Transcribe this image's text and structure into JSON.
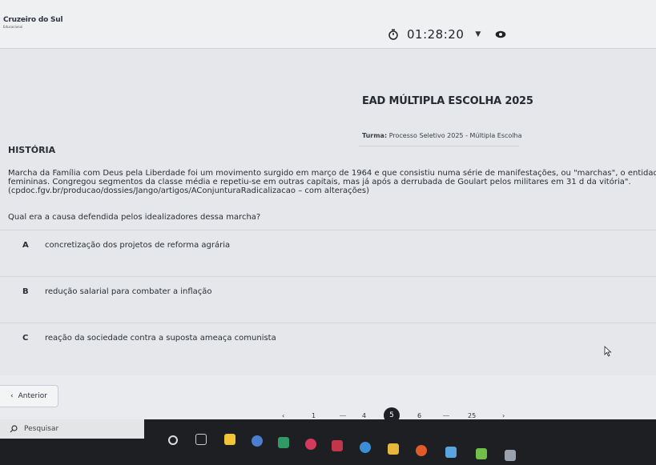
{
  "header": {
    "brand_name": "Cruzeiro do Sul",
    "brand_sub": "Educacional",
    "timer": "01:28:20"
  },
  "exam": {
    "title": "EAD MÚLTIPLA ESCOLHA 2025",
    "turma_label": "Turma:",
    "turma_value": "Processo Seletivo 2025 - Múltipla Escolha"
  },
  "question": {
    "subject": "HISTÓRIA",
    "passage": "Marcha da Família com Deus pela Liberdade foi um movimento surgido em março de 1964 e que consistiu numa série de manifestações, ou \"marchas\", o entidades femininas. Congregou segmentos da classe média e repetiu-se em outras capitais, mas já após a derrubada de Goulart pelos militares em 31 d da vitória\". (cpdoc.fgv.br/producao/dossies/Jango/artigos/AConjunturaRadicalizacao – com alterações)",
    "prompt": "Qual era a causa defendida pelos idealizadores dessa marcha?",
    "options": [
      {
        "letter": "A",
        "text": "concretização dos projetos de reforma agrária"
      },
      {
        "letter": "B",
        "text": "redução salarial para combater a inflação"
      },
      {
        "letter": "C",
        "text": "reação da sociedade contra a suposta ameaça comunista"
      }
    ]
  },
  "navigation": {
    "prev_label": "Anterior",
    "pages": [
      "1",
      "4",
      "5",
      "6",
      "25"
    ],
    "current_page": "5",
    "prev_arrow": "‹",
    "next_arrow": "›"
  },
  "taskbar": {
    "search_placeholder": "Pesquisar"
  },
  "colors": {
    "active_page": "#1d1f24",
    "taskbar": "#1d1f22"
  }
}
